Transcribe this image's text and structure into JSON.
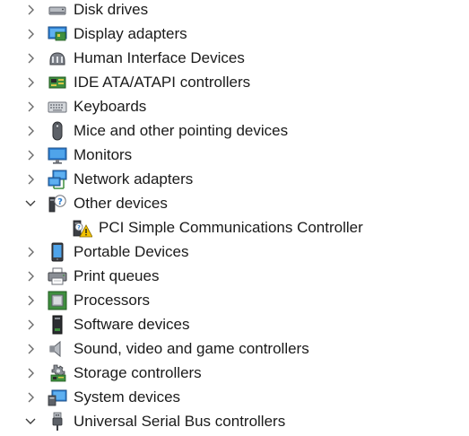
{
  "tree": {
    "items": [
      {
        "label": "Disk drives",
        "expanded": false,
        "icon": "disk-drive-icon"
      },
      {
        "label": "Display adapters",
        "expanded": false,
        "icon": "display-adapter-icon"
      },
      {
        "label": "Human Interface Devices",
        "expanded": false,
        "icon": "hid-icon"
      },
      {
        "label": "IDE ATA/ATAPI controllers",
        "expanded": false,
        "icon": "ide-controller-icon"
      },
      {
        "label": "Keyboards",
        "expanded": false,
        "icon": "keyboard-icon"
      },
      {
        "label": "Mice and other pointing devices",
        "expanded": false,
        "icon": "mouse-icon"
      },
      {
        "label": "Monitors",
        "expanded": false,
        "icon": "monitor-icon"
      },
      {
        "label": "Network adapters",
        "expanded": false,
        "icon": "network-adapter-icon"
      },
      {
        "label": "Other devices",
        "expanded": true,
        "icon": "unknown-device-icon"
      },
      {
        "label": "PCI Simple Communications Controller",
        "child": true,
        "icon": "warning-device-icon"
      },
      {
        "label": "Portable Devices",
        "expanded": false,
        "icon": "portable-device-icon"
      },
      {
        "label": "Print queues",
        "expanded": false,
        "icon": "printer-icon"
      },
      {
        "label": "Processors",
        "expanded": false,
        "icon": "processor-icon"
      },
      {
        "label": "Software devices",
        "expanded": false,
        "icon": "software-device-icon"
      },
      {
        "label": "Sound, video and game controllers",
        "expanded": false,
        "icon": "speaker-icon"
      },
      {
        "label": "Storage controllers",
        "expanded": false,
        "icon": "storage-controller-icon"
      },
      {
        "label": "System devices",
        "expanded": false,
        "icon": "system-device-icon"
      },
      {
        "label": "Universal Serial Bus controllers",
        "expanded": true,
        "icon": "usb-icon"
      }
    ]
  },
  "colors": {
    "text": "#1a1a1a",
    "chevron": "#6b6b6b",
    "monitor_blue": "#2e7fd1",
    "warning_yellow": "#f2c200"
  }
}
